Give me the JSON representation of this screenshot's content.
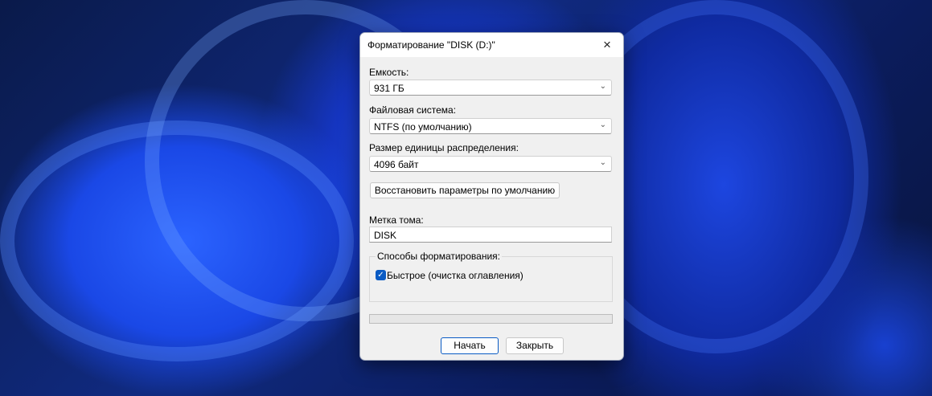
{
  "dialog": {
    "title": "Форматирование \"DISK (D:)\"",
    "close_icon": "×"
  },
  "capacity": {
    "label": "Емкость:",
    "value": "931 ГБ"
  },
  "filesystem": {
    "label": "Файловая система:",
    "value": "NTFS (по умолчанию)"
  },
  "allocation": {
    "label": "Размер единицы распределения:",
    "value": "4096 байт"
  },
  "restore_defaults_label": "Восстановить параметры по умолчанию",
  "volume_label": {
    "label": "Метка тома:",
    "value": "DISK"
  },
  "format_options": {
    "legend": "Способы форматирования:",
    "quick_format": {
      "label": "Быстрое (очистка оглавления)",
      "checked": true
    }
  },
  "progress": 0,
  "buttons": {
    "start": "Начать",
    "close": "Закрыть"
  },
  "colors": {
    "accent": "#0a5bc4"
  }
}
